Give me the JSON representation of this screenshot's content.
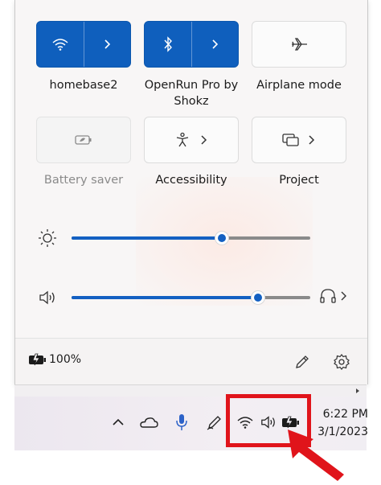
{
  "quick_settings": {
    "tiles": [
      {
        "label": "homebase2",
        "state": "on",
        "icon": "wifi-icon",
        "has_chevron": true
      },
      {
        "label": "OpenRun Pro by Shokz",
        "state": "on",
        "icon": "bluetooth-icon",
        "has_chevron": true
      },
      {
        "label": "Airplane mode",
        "state": "off",
        "icon": "airplane-icon",
        "has_chevron": false
      },
      {
        "label": "Battery saver",
        "state": "disabled",
        "icon": "battery-saver-icon",
        "has_chevron": false
      },
      {
        "label": "Accessibility",
        "state": "off",
        "icon": "accessibility-icon",
        "has_chevron": true
      },
      {
        "label": "Project",
        "state": "off",
        "icon": "project-icon",
        "has_chevron": true
      }
    ],
    "brightness": {
      "icon": "brightness-icon",
      "level_percent": 63
    },
    "volume": {
      "icon": "speaker-icon",
      "level_percent": 78,
      "output_icon": "headphones-icon"
    },
    "footer": {
      "battery_percent": "100%",
      "battery_icon": "battery-charging-icon",
      "edit_icon": "pencil-icon",
      "settings_icon": "gear-icon"
    }
  },
  "taskbar": {
    "tray_icons": [
      "chevron-up-icon",
      "onedrive-cloud-icon",
      "microphone-icon",
      "pen-icon",
      "wifi-icon",
      "speaker-icon",
      "battery-charging-icon"
    ],
    "time": "6:22 PM",
    "date": "3/1/2023"
  },
  "colors": {
    "accent": "#0f5fbd",
    "annotation": "#e0141b"
  }
}
